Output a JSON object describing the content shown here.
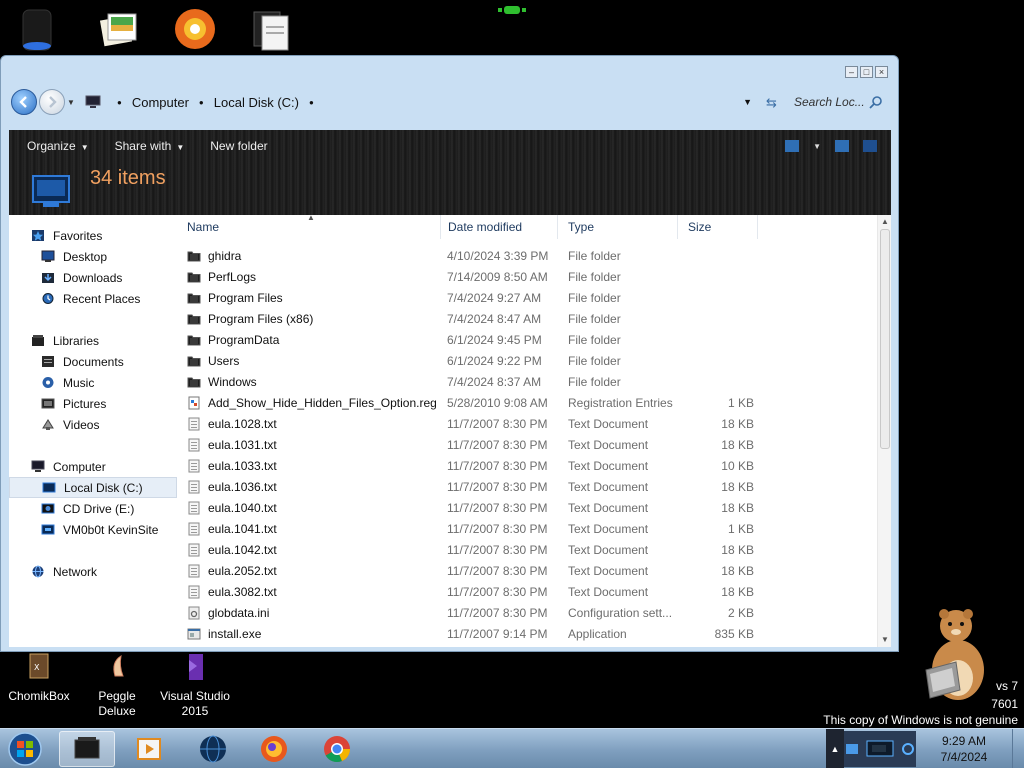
{
  "window": {
    "controls": {
      "minimize": "–",
      "maximize": "□",
      "close": "×"
    }
  },
  "address": {
    "breadcrumbs": [
      "Computer",
      "Local Disk (C:)"
    ],
    "search_placeholder": "Search Loc..."
  },
  "toolbar": {
    "organize": "Organize",
    "share_with": "Share with",
    "new_folder": "New folder",
    "item_count": "34 items"
  },
  "nav": {
    "groups": [
      {
        "label": "Favorites",
        "icon": "star-icon",
        "items": [
          {
            "label": "Desktop",
            "icon": "desktop-icon"
          },
          {
            "label": "Downloads",
            "icon": "downloads-icon"
          },
          {
            "label": "Recent Places",
            "icon": "recent-places-icon"
          }
        ]
      },
      {
        "label": "Libraries",
        "icon": "libraries-icon",
        "items": [
          {
            "label": "Documents",
            "icon": "documents-icon"
          },
          {
            "label": "Music",
            "icon": "music-icon"
          },
          {
            "label": "Pictures",
            "icon": "pictures-icon"
          },
          {
            "label": "Videos",
            "icon": "videos-icon"
          }
        ]
      },
      {
        "label": "Computer",
        "icon": "computer-icon",
        "items": [
          {
            "label": "Local Disk (C:)",
            "icon": "drive-icon",
            "selected": true
          },
          {
            "label": "CD Drive (E:)",
            "icon": "cd-drive-icon"
          },
          {
            "label": "VM0b0t KevinSite",
            "icon": "network-drive-icon"
          }
        ]
      },
      {
        "label": "Network",
        "icon": "network-icon",
        "items": []
      }
    ]
  },
  "columns": {
    "name": "Name",
    "date": "Date modified",
    "type": "Type",
    "size": "Size"
  },
  "files": [
    {
      "name": "ghidra",
      "date": "4/10/2024 3:39 PM",
      "type": "File folder",
      "size": "",
      "icon": "folder-icon"
    },
    {
      "name": "PerfLogs",
      "date": "7/14/2009 8:50 AM",
      "type": "File folder",
      "size": "",
      "icon": "folder-icon"
    },
    {
      "name": "Program Files",
      "date": "7/4/2024 9:27 AM",
      "type": "File folder",
      "size": "",
      "icon": "folder-icon"
    },
    {
      "name": "Program Files (x86)",
      "date": "7/4/2024 8:47 AM",
      "type": "File folder",
      "size": "",
      "icon": "folder-icon"
    },
    {
      "name": "ProgramData",
      "date": "6/1/2024 9:45 PM",
      "type": "File folder",
      "size": "",
      "icon": "folder-icon"
    },
    {
      "name": "Users",
      "date": "6/1/2024 9:22 PM",
      "type": "File folder",
      "size": "",
      "icon": "folder-icon"
    },
    {
      "name": "Windows",
      "date": "7/4/2024 8:37 AM",
      "type": "File folder",
      "size": "",
      "icon": "folder-icon"
    },
    {
      "name": "Add_Show_Hide_Hidden_Files_Option.reg",
      "date": "5/28/2010 9:08 AM",
      "type": "Registration Entries",
      "size": "1 KB",
      "icon": "registry-file-icon"
    },
    {
      "name": "eula.1028.txt",
      "date": "11/7/2007 8:30 PM",
      "type": "Text Document",
      "size": "18 KB",
      "icon": "text-file-icon"
    },
    {
      "name": "eula.1031.txt",
      "date": "11/7/2007 8:30 PM",
      "type": "Text Document",
      "size": "18 KB",
      "icon": "text-file-icon"
    },
    {
      "name": "eula.1033.txt",
      "date": "11/7/2007 8:30 PM",
      "type": "Text Document",
      "size": "10 KB",
      "icon": "text-file-icon"
    },
    {
      "name": "eula.1036.txt",
      "date": "11/7/2007 8:30 PM",
      "type": "Text Document",
      "size": "18 KB",
      "icon": "text-file-icon"
    },
    {
      "name": "eula.1040.txt",
      "date": "11/7/2007 8:30 PM",
      "type": "Text Document",
      "size": "18 KB",
      "icon": "text-file-icon"
    },
    {
      "name": "eula.1041.txt",
      "date": "11/7/2007 8:30 PM",
      "type": "Text Document",
      "size": "1 KB",
      "icon": "text-file-icon"
    },
    {
      "name": "eula.1042.txt",
      "date": "11/7/2007 8:30 PM",
      "type": "Text Document",
      "size": "18 KB",
      "icon": "text-file-icon"
    },
    {
      "name": "eula.2052.txt",
      "date": "11/7/2007 8:30 PM",
      "type": "Text Document",
      "size": "18 KB",
      "icon": "text-file-icon"
    },
    {
      "name": "eula.3082.txt",
      "date": "11/7/2007 8:30 PM",
      "type": "Text Document",
      "size": "18 KB",
      "icon": "text-file-icon"
    },
    {
      "name": "globdata.ini",
      "date": "11/7/2007 8:30 PM",
      "type": "Configuration sett...",
      "size": "2 KB",
      "icon": "config-file-icon"
    },
    {
      "name": "install.exe",
      "date": "11/7/2007 9:14 PM",
      "type": "Application",
      "size": "835 KB",
      "icon": "application-icon"
    }
  ],
  "desktop_icons": [
    {
      "label": "ChomikBox",
      "icon": "chomikbox-icon"
    },
    {
      "label": "Peggle Deluxe",
      "icon": "peggle-icon"
    },
    {
      "label": "Visual Studio 2015",
      "icon": "visual-studio-icon"
    }
  ],
  "watermark": {
    "line1": "vs 7",
    "line2": "7601",
    "line3": "This copy of Windows is not genuine"
  },
  "taskbar": {
    "time": "9:29 AM",
    "date": "7/4/2024",
    "tray_arrow": "▲"
  },
  "colors": {
    "accent": "#f0a060",
    "window_frame": "#c9dff3",
    "selection": "#e6eef7"
  }
}
